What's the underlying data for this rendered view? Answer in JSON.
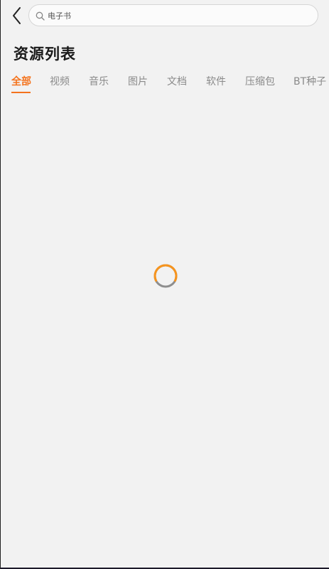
{
  "header": {
    "back_icon": "chevron-left-icon",
    "search": {
      "icon": "search-icon",
      "placeholder": "电子书",
      "value": ""
    }
  },
  "page": {
    "title": "资源列表"
  },
  "tabs": [
    {
      "label": "全部",
      "active": true
    },
    {
      "label": "视频",
      "active": false
    },
    {
      "label": "音乐",
      "active": false
    },
    {
      "label": "图片",
      "active": false
    },
    {
      "label": "文档",
      "active": false
    },
    {
      "label": "软件",
      "active": false
    },
    {
      "label": "压缩包",
      "active": false
    },
    {
      "label": "BT种子",
      "active": false
    }
  ],
  "loading": {
    "icon": "loading-spinner-icon"
  },
  "colors": {
    "accent": "#f4731d",
    "spinner_primary": "#f7941d",
    "spinner_secondary": "#8e8e8e",
    "background": "#f2f2f2"
  }
}
